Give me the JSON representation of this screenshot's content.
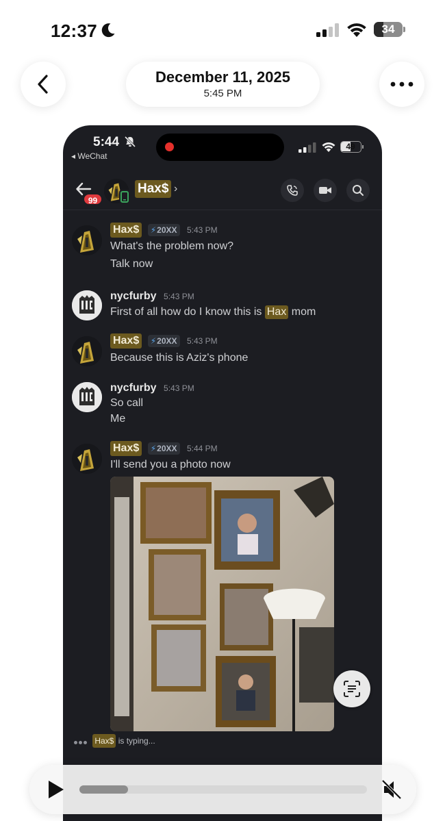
{
  "status_bar": {
    "time": "12:37",
    "icons": [
      "moon-icon",
      "cellular-signal-icon",
      "wifi-icon",
      "battery-icon"
    ],
    "battery_level": "34",
    "battery_fraction": 0.34
  },
  "header": {
    "date": "December 11, 2025",
    "time": "5:45 PM",
    "back_icon": "chevron-left-icon",
    "more_icon": "ellipsis-icon"
  },
  "screenshot": {
    "status_bar": {
      "time": "5:44",
      "back_app": "◂ WeChat",
      "battery_level": "49",
      "battery_fraction": 0.49,
      "recording_color": "#e5302b"
    },
    "dm_header": {
      "unread_badge": "99",
      "name": "Hax$",
      "chevron": "›",
      "actions": [
        "voice-call-icon",
        "video-call-icon",
        "search-icon"
      ]
    },
    "messages": [
      {
        "author": "Hax$",
        "highlight": true,
        "tag": "20XX",
        "time": "5:43 PM",
        "lines": [
          "What's the problem now?",
          "Talk now"
        ]
      },
      {
        "author": "nycfurby",
        "highlight": false,
        "tag": "",
        "time": "5:43 PM",
        "line_before": "First of all how do I know this is",
        "mention": "Hax",
        "line_after": "mom"
      },
      {
        "author": "Hax$",
        "highlight": true,
        "tag": "20XX",
        "time": "5:43 PM",
        "lines": [
          "Because this is Aziz's phone"
        ]
      },
      {
        "author": "nycfurby",
        "highlight": false,
        "tag": "",
        "time": "5:43 PM",
        "lines": [
          "So call",
          "Me"
        ]
      },
      {
        "author": "Hax$",
        "highlight": true,
        "tag": "20XX",
        "time": "5:44 PM",
        "lines": [
          "I'll send you a photo now"
        ],
        "attachment": "photo"
      }
    ],
    "typing": {
      "user": "Hax$",
      "text": "is typing..."
    },
    "colors": {
      "background": "#1c1d22",
      "highlight": "#6c5a1f",
      "text": "#cfd0d3",
      "badge": "#e03a3e"
    }
  },
  "player": {
    "progress": 0.17,
    "play_icon": "play-icon",
    "mute_icon": "speaker-muted-icon"
  }
}
